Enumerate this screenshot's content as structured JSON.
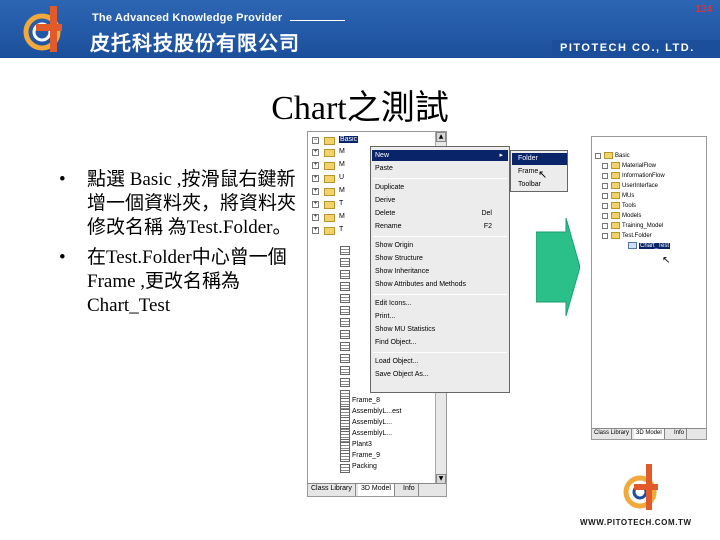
{
  "header": {
    "tagline": "The Advanced Knowledge Provider",
    "company_cn": "皮托科技股份有限公司",
    "company_en": "PITOTECH CO., LTD.",
    "page_number": "134"
  },
  "slide": {
    "title": "Chart之測試",
    "bullets": [
      "點選 Basic ,按滑鼠右鍵新增一個資料夾，將資料夾修改名稱 為Test.Folder。",
      "在Test.Folder中心曾一個 Frame ,更改名稱為 Chart_Test"
    ],
    "bullet_symbol": "•"
  },
  "left_tree": {
    "root_label": "Basic",
    "top_folders": [
      "M",
      "M",
      "U",
      "M",
      "T",
      "M",
      "T"
    ],
    "leaf_items": [
      "Frame_8",
      "AssemblyL...est",
      "AssemblyL...",
      "AssemblyL...",
      "Plant3",
      "Frame_9",
      "Packing"
    ],
    "tabs": [
      "Class Library",
      "3D Model",
      "Info"
    ],
    "active_tab": 1
  },
  "context_menu": {
    "items": [
      {
        "label": "New",
        "shortcut": "",
        "submenu": true,
        "highlighted": true
      },
      {
        "label": "Paste",
        "shortcut": "",
        "submenu": false,
        "highlighted": false
      },
      {
        "sep": true
      },
      {
        "label": "Duplicate",
        "shortcut": "",
        "submenu": false,
        "highlighted": false
      },
      {
        "label": "Derive",
        "shortcut": "",
        "submenu": false,
        "highlighted": false
      },
      {
        "label": "Delete",
        "shortcut": "Del",
        "submenu": false,
        "highlighted": false
      },
      {
        "label": "Rename",
        "shortcut": "F2",
        "submenu": false,
        "highlighted": false
      },
      {
        "sep": true
      },
      {
        "label": "Show Origin",
        "shortcut": "",
        "submenu": false,
        "highlighted": false
      },
      {
        "label": "Show Structure",
        "shortcut": "",
        "submenu": false,
        "highlighted": false
      },
      {
        "label": "Show Inheritance",
        "shortcut": "",
        "submenu": false,
        "highlighted": false
      },
      {
        "label": "Show Attributes and Methods",
        "shortcut": "",
        "submenu": false,
        "highlighted": false
      },
      {
        "sep": true
      },
      {
        "label": "Edit Icons...",
        "shortcut": "",
        "submenu": false,
        "highlighted": false
      },
      {
        "label": "Print...",
        "shortcut": "",
        "submenu": false,
        "highlighted": false
      },
      {
        "label": "Show MU Statistics",
        "shortcut": "",
        "submenu": false,
        "highlighted": false
      },
      {
        "label": "Find Object...",
        "shortcut": "",
        "submenu": false,
        "highlighted": false
      },
      {
        "sep": true
      },
      {
        "label": "Load Object...",
        "shortcut": "",
        "submenu": false,
        "highlighted": false
      },
      {
        "label": "Save Object As...",
        "shortcut": "",
        "submenu": false,
        "highlighted": false
      }
    ]
  },
  "submenu": {
    "items": [
      "Folder",
      "Frame",
      "Toolbar"
    ],
    "highlighted_index": 0
  },
  "right_tree": {
    "root_label": "Basic",
    "folders": [
      "MaterialFlow",
      "InformationFlow",
      "UserInterface",
      "MUs",
      "Tools",
      "Models",
      "Training_Model",
      "Test.Folder"
    ],
    "selected_child": "Chart_Test",
    "tabs": [
      "Class Library",
      "3D Model",
      "Info"
    ],
    "active_tab": 1
  },
  "footer": {
    "url": "WWW.PITOTECH.COM.TW"
  },
  "colors": {
    "brand_blue": "#1b4f9c",
    "accent_green": "#2bbf8a",
    "menu_highlight": "#0a246a"
  }
}
